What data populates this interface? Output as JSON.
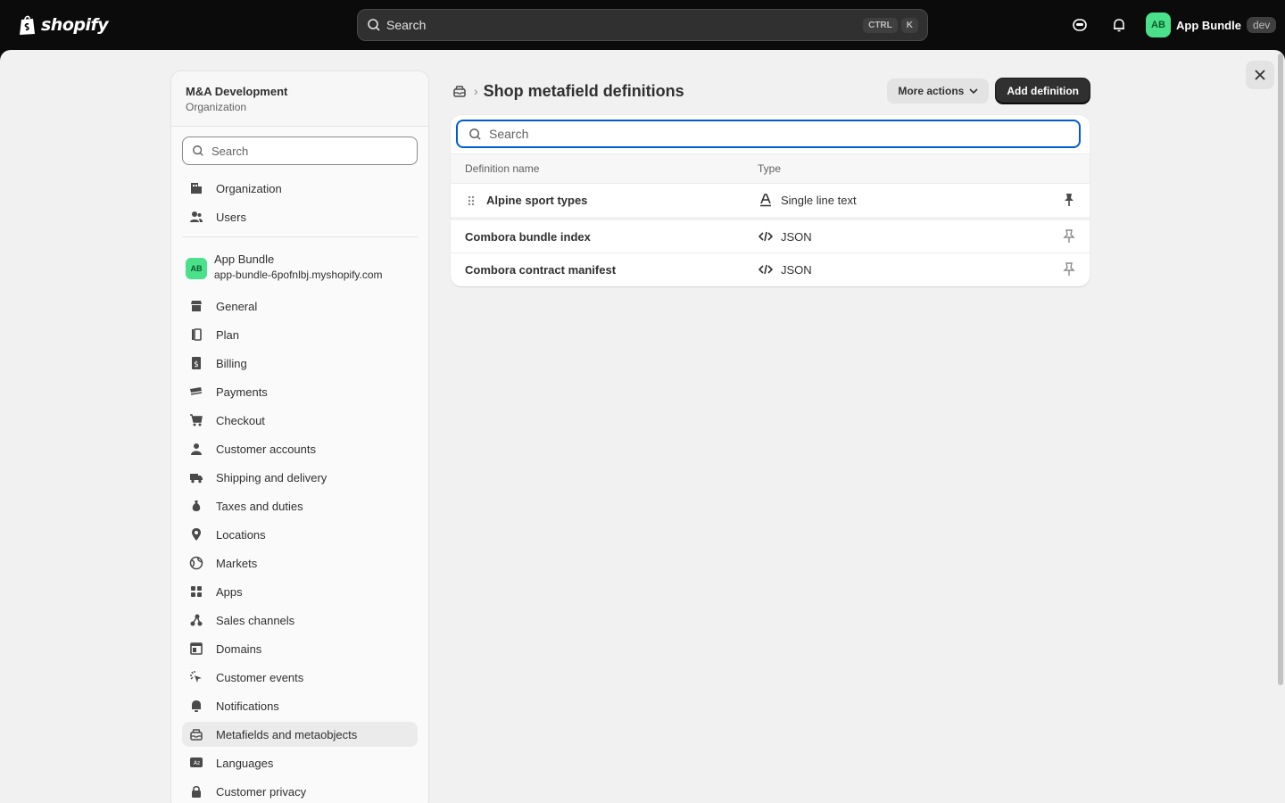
{
  "topbar": {
    "logo_text": "shopify",
    "search_placeholder": "Search",
    "shortcut_keys": [
      "CTRL",
      "K"
    ],
    "store_initials": "AB",
    "store_name": "App Bundle",
    "env_badge": "dev"
  },
  "sidebar": {
    "org_name": "M&A Development",
    "org_sub": "Organization",
    "search_placeholder": "Search",
    "org_items": [
      {
        "label": "Organization",
        "icon": "organization-icon"
      },
      {
        "label": "Users",
        "icon": "users-icon"
      }
    ],
    "store": {
      "initials": "AB",
      "name": "App Bundle",
      "domain": "app-bundle-6pofnlbj.myshopify.com"
    },
    "items": [
      {
        "label": "General",
        "icon": "store-icon"
      },
      {
        "label": "Plan",
        "icon": "plan-icon"
      },
      {
        "label": "Billing",
        "icon": "billing-icon"
      },
      {
        "label": "Payments",
        "icon": "payments-icon"
      },
      {
        "label": "Checkout",
        "icon": "cart-icon"
      },
      {
        "label": "Customer accounts",
        "icon": "person-icon"
      },
      {
        "label": "Shipping and delivery",
        "icon": "truck-icon"
      },
      {
        "label": "Taxes and duties",
        "icon": "tax-icon"
      },
      {
        "label": "Locations",
        "icon": "location-icon"
      },
      {
        "label": "Markets",
        "icon": "globe-icon"
      },
      {
        "label": "Apps",
        "icon": "apps-icon"
      },
      {
        "label": "Sales channels",
        "icon": "channels-icon"
      },
      {
        "label": "Domains",
        "icon": "domain-icon"
      },
      {
        "label": "Customer events",
        "icon": "cursor-icon"
      },
      {
        "label": "Notifications",
        "icon": "bell-icon"
      },
      {
        "label": "Metafields and metaobjects",
        "icon": "metafields-icon",
        "active": true
      },
      {
        "label": "Languages",
        "icon": "language-icon"
      },
      {
        "label": "Customer privacy",
        "icon": "lock-icon"
      }
    ]
  },
  "page": {
    "title": "Shop metafield definitions",
    "more_actions": "More actions",
    "add_definition": "Add definition",
    "search_placeholder": "Search",
    "columns": {
      "name": "Definition name",
      "type": "Type"
    },
    "rows": [
      {
        "name": "Alpine sport types",
        "type": "Single line text",
        "type_icon": "text-icon",
        "pinned": true
      },
      {
        "name": "Combora bundle index",
        "type": "JSON",
        "type_icon": "code-icon",
        "pinned": false
      },
      {
        "name": "Combora contract manifest",
        "type": "JSON",
        "type_icon": "code-icon",
        "pinned": false
      }
    ]
  },
  "colors": {
    "accent_focus": "#005bd3",
    "primary_button": "#303030",
    "avatar": "#4be08a"
  }
}
